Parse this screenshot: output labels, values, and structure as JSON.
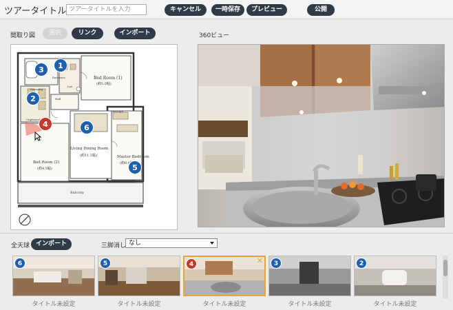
{
  "header": {
    "tour_title_label": "ツアータイトル：",
    "tour_title_placeholder": "ツアータイトルを入力",
    "cancel_label": "キャンセル",
    "save_draft_label": "一時保存",
    "preview_label": "プレビュー",
    "publish_label": "公開"
  },
  "floorplan": {
    "section_label": "間取り図",
    "select_label": "選択",
    "link_label": "リンク",
    "import_label": "インポート",
    "rooms": {
      "entrance": "Entrance",
      "bedroom1": "Bed Room (1)",
      "bedroom1_size": "(約5.0帖)",
      "dressing": "Dressing",
      "hall": "Hall",
      "lav": "Lav.",
      "storage": "Storage",
      "living": "Living Dining Room",
      "living_size": "(約11.5帖)",
      "bedroom2": "Bed Room (2)",
      "bedroom2_size": "(約4.5帖)",
      "master": "Master Bedroom",
      "master_size": "(約6.0帖)",
      "balcony": "Balcony",
      "cupboard": "Cupboard"
    },
    "markers": [
      {
        "num": "1",
        "color": "#1f5fb0"
      },
      {
        "num": "2",
        "color": "#1f5fb0"
      },
      {
        "num": "3",
        "color": "#1f5fb0"
      },
      {
        "num": "4",
        "color": "#c0392b"
      },
      {
        "num": "5",
        "color": "#1f5fb0"
      },
      {
        "num": "6",
        "color": "#1f5fb0"
      }
    ]
  },
  "viewer": {
    "section_label": "360ビュー"
  },
  "panorama": {
    "section_label": "全天球",
    "import_label": "インポート",
    "tripod_label": "三脚消し",
    "tripod_value": "なし",
    "items": [
      {
        "num": "6",
        "title": "タイトル未設定",
        "selected": false
      },
      {
        "num": "5",
        "title": "タイトル未設定",
        "selected": false
      },
      {
        "num": "4",
        "title": "タイトル未設定",
        "selected": true
      },
      {
        "num": "3",
        "title": "タイトル未設定",
        "selected": false
      },
      {
        "num": "2",
        "title": "タイトル未設定",
        "selected": false
      }
    ],
    "close_glyph": "✕"
  },
  "colors": {
    "dark_button": "#2f3b46",
    "selected_border": "#e8a33d",
    "marker_blue": "#1f5fb0",
    "marker_red": "#c0392b"
  }
}
